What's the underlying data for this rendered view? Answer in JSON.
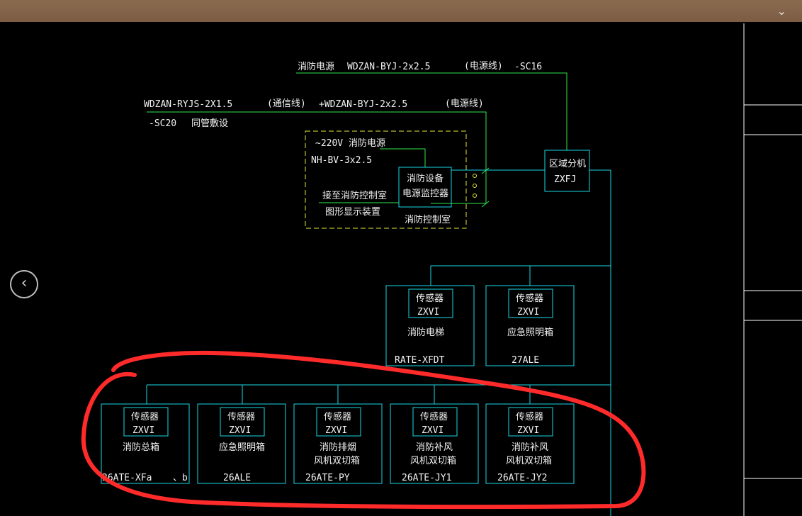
{
  "app": {
    "chevron_icon": "chevron-down-icon"
  },
  "nav": {
    "back_icon": "chevron-left-icon"
  },
  "colors": {
    "cyan": "#19d7e6",
    "green": "#2ee84a",
    "yellow": "#e6e63c",
    "red": "#ff2a2a",
    "white": "#f2f2f2"
  },
  "cables": {
    "top_line": {
      "label_a": "消防电源",
      "label_b": "WDZAN-BYJ-2x2.5",
      "label_c": "(电源线)",
      "label_d": "-SC16"
    },
    "second_line": {
      "label_a": "WDZAN-RYJS-2X1.5",
      "label_b": "(通信线)",
      "label_c": "+WDZAN-BYJ-2x2.5",
      "label_d": "(电源线)"
    },
    "second_sub": {
      "label_a": "-SC20",
      "label_b": "同管敷设"
    }
  },
  "control_room": {
    "line1": "~220V 消防电源",
    "line2": "NH-BV-3x2.5",
    "connect_text_1": "接至消防控制室",
    "connect_text_2": "图形显示装置",
    "monitor_line1": "消防设备",
    "monitor_line2": "电源监控器",
    "room_label": "消防控制室"
  },
  "zone_splitter": {
    "line1": "区域分机",
    "line2": "ZXFJ"
  },
  "devices": [
    {
      "sensor": "传感器",
      "code": "ZXVI",
      "name1": "消防电梯",
      "name2": "",
      "id": "RATE-XFDT"
    },
    {
      "sensor": "传感器",
      "code": "ZXVI",
      "name1": "应急照明箱",
      "name2": "",
      "id": "27ALE"
    },
    {
      "sensor": "传感器",
      "code": "ZXVI",
      "name1": "消防总箱",
      "name2": "",
      "id": "26ATE-XFa",
      "id_suffix": "、b"
    },
    {
      "sensor": "传感器",
      "code": "ZXVI",
      "name1": "应急照明箱",
      "name2": "",
      "id": "26ALE"
    },
    {
      "sensor": "传感器",
      "code": "ZXVI",
      "name1": "消防排烟",
      "name2": "风机双切箱",
      "id": "26ATE-PY"
    },
    {
      "sensor": "传感器",
      "code": "ZXVI",
      "name1": "消防补风",
      "name2": "风机双切箱",
      "id": "26ATE-JY1"
    },
    {
      "sensor": "传感器",
      "code": "ZXVI",
      "name1": "消防补风",
      "name2": "风机双切箱",
      "id": "26ATE-JY2"
    }
  ]
}
